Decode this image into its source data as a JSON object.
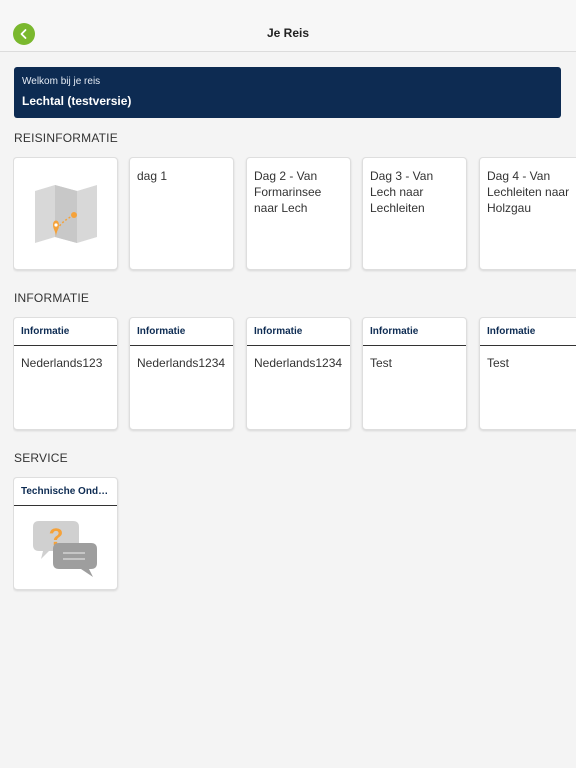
{
  "header": {
    "title": "Je Reis",
    "back_icon": "chevron-left-icon"
  },
  "welcome": {
    "subtitle": "Welkom bij je reis",
    "title": "Lechtal (testversie)"
  },
  "reisinformatie": {
    "section_title": "REISINFORMATIE",
    "map_icon": "map-pin-icon",
    "cards": [
      {
        "label": "dag 1"
      },
      {
        "label": "Dag 2 - Van Formarinsee naar Lech"
      },
      {
        "label": "Dag 3 - Van Lech naar Lechleiten"
      },
      {
        "label": "Dag 4 - Van Lechleiten naar Holzgau"
      }
    ]
  },
  "informatie": {
    "section_title": "INFORMATIE",
    "cards": [
      {
        "heading": "Informatie",
        "text": "Nederlands123"
      },
      {
        "heading": "Informatie",
        "text": "Nederlands1234"
      },
      {
        "heading": "Informatie",
        "text": "Nederlands1234"
      },
      {
        "heading": "Informatie",
        "text": "Test"
      },
      {
        "heading": "Informatie",
        "text": "Test"
      }
    ]
  },
  "service": {
    "section_title": "SERVICE",
    "cards": [
      {
        "heading": "Technische Onder...",
        "icon": "question-chat-icon"
      }
    ]
  },
  "colors": {
    "accent_green": "#7ab82e",
    "brand_navy": "#0d2b52",
    "orange": "#f5a23a"
  }
}
